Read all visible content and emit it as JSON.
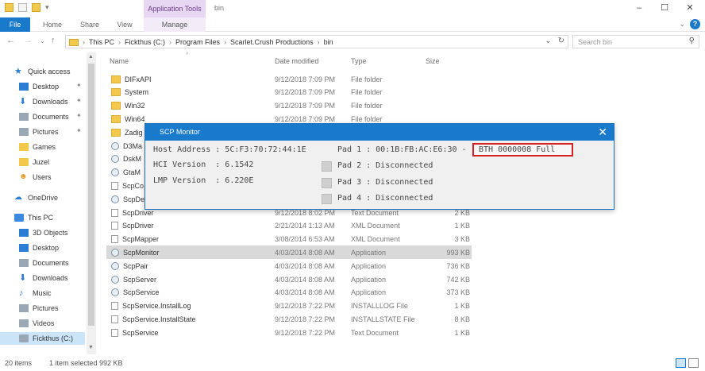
{
  "window": {
    "title": "bin",
    "context_tab": "Application Tools"
  },
  "ribbon": {
    "tabs": [
      "File",
      "Home",
      "Share",
      "View",
      "Manage"
    ]
  },
  "address": {
    "crumbs": [
      "This PC",
      "Fickthus (C:)",
      "Program Files",
      "Scarlet.Crush Productions",
      "bin"
    ],
    "search_placeholder": "Search bin"
  },
  "nav": {
    "items": [
      {
        "label": "Quick access",
        "icon": "star-icon",
        "pinned": false
      },
      {
        "label": "Desktop",
        "icon": "desktop-icon",
        "pinned": true
      },
      {
        "label": "Downloads",
        "icon": "download-icon",
        "pinned": true
      },
      {
        "label": "Documents",
        "icon": "documents-icon",
        "pinned": true
      },
      {
        "label": "Pictures",
        "icon": "pictures-icon",
        "pinned": true
      },
      {
        "label": "Games",
        "icon": "folder-icon",
        "pinned": false
      },
      {
        "label": "Juzel",
        "icon": "folder-icon",
        "pinned": false
      },
      {
        "label": "Users",
        "icon": "folder-icon",
        "pinned": false
      },
      {
        "label": "OneDrive",
        "icon": "cloud-icon",
        "pinned": false
      },
      {
        "label": "This PC",
        "icon": "computer-icon",
        "pinned": false
      },
      {
        "label": "3D Objects",
        "icon": "cube-icon",
        "pinned": false
      },
      {
        "label": "Desktop",
        "icon": "desktop-icon",
        "pinned": false
      },
      {
        "label": "Documents",
        "icon": "documents-icon",
        "pinned": false
      },
      {
        "label": "Downloads",
        "icon": "download-icon",
        "pinned": false
      },
      {
        "label": "Music",
        "icon": "music-icon",
        "pinned": false
      },
      {
        "label": "Pictures",
        "icon": "pictures-icon",
        "pinned": false
      },
      {
        "label": "Videos",
        "icon": "video-icon",
        "pinned": false
      },
      {
        "label": "Fickthus (C:)",
        "icon": "drive-icon",
        "pinned": false
      }
    ]
  },
  "columns": {
    "name": "Name",
    "date": "Date modified",
    "type": "Type",
    "size": "Size"
  },
  "files": [
    {
      "name": "DIFxAPI",
      "date": "9/12/2018 7:09 PM",
      "type": "File folder",
      "size": "",
      "icon": "folder"
    },
    {
      "name": "System",
      "date": "9/12/2018 7:09 PM",
      "type": "File folder",
      "size": "",
      "icon": "folder"
    },
    {
      "name": "Win32",
      "date": "9/12/2018 7:09 PM",
      "type": "File folder",
      "size": "",
      "icon": "folder"
    },
    {
      "name": "Win64",
      "date": "9/12/2018 7:09 PM",
      "type": "File folder",
      "size": "",
      "icon": "folder"
    },
    {
      "name": "Zadig",
      "date": "",
      "type": "",
      "size": "",
      "icon": "folder"
    },
    {
      "name": "D3Ma",
      "date": "",
      "type": "",
      "size": "",
      "icon": "gear"
    },
    {
      "name": "DskM",
      "date": "",
      "type": "",
      "size": "",
      "icon": "gear"
    },
    {
      "name": "GtaM",
      "date": "",
      "type": "",
      "size": "",
      "icon": "gear"
    },
    {
      "name": "ScpCo",
      "date": "",
      "type": "",
      "size": "",
      "icon": "doc"
    },
    {
      "name": "ScpDe",
      "date": "",
      "type": "",
      "size": "",
      "icon": "gear"
    },
    {
      "name": "ScpDriver",
      "date": "9/12/2018 8:02 PM",
      "type": "Text Document",
      "size": "2 KB",
      "icon": "doc"
    },
    {
      "name": "ScpDriver",
      "date": "2/21/2014 1:13 AM",
      "type": "XML Document",
      "size": "1 KB",
      "icon": "doc"
    },
    {
      "name": "ScpMapper",
      "date": "3/08/2014 6:53 AM",
      "type": "XML Document",
      "size": "3 KB",
      "icon": "doc"
    },
    {
      "name": "ScpMonitor",
      "date": "4/03/2014 8:08 AM",
      "type": "Application",
      "size": "993 KB",
      "icon": "gear",
      "selected": true
    },
    {
      "name": "ScpPair",
      "date": "4/03/2014 8:08 AM",
      "type": "Application",
      "size": "736 KB",
      "icon": "gear"
    },
    {
      "name": "ScpServer",
      "date": "4/03/2014 8:08 AM",
      "type": "Application",
      "size": "742 KB",
      "icon": "gear"
    },
    {
      "name": "ScpService",
      "date": "4/03/2014 8:08 AM",
      "type": "Application",
      "size": "373 KB",
      "icon": "gear"
    },
    {
      "name": "ScpService.InstallLog",
      "date": "9/12/2018 7:22 PM",
      "type": "INSTALLLOG File",
      "size": "1 KB",
      "icon": "doc"
    },
    {
      "name": "ScpService.InstallState",
      "date": "9/12/2018 7:22 PM",
      "type": "INSTALLSTATE File",
      "size": "8 KB",
      "icon": "doc"
    },
    {
      "name": "ScpService",
      "date": "9/12/2018 7:22 PM",
      "type": "Text Document",
      "size": "1 KB",
      "icon": "doc"
    }
  ],
  "dialog": {
    "title": "SCP Monitor",
    "host_address": "Host Address : 5C:F3:70:72:44:1E",
    "hci_version": "HCI Version  : 6.1542",
    "lmp_version": "LMP Version  : 6.220E",
    "pad1": "Pad 1 : 00:1B:FB:AC:E6:30 -",
    "pad1_status": "BTH 0000008 Full",
    "pad2": "Pad 2 : Disconnected",
    "pad3": "Pad 3 : Disconnected",
    "pad4": "Pad 4 : Disconnected",
    "highlight_color": "#d42020"
  },
  "status": {
    "item_count": "20 items",
    "selection": "1 item selected  992 KB"
  }
}
